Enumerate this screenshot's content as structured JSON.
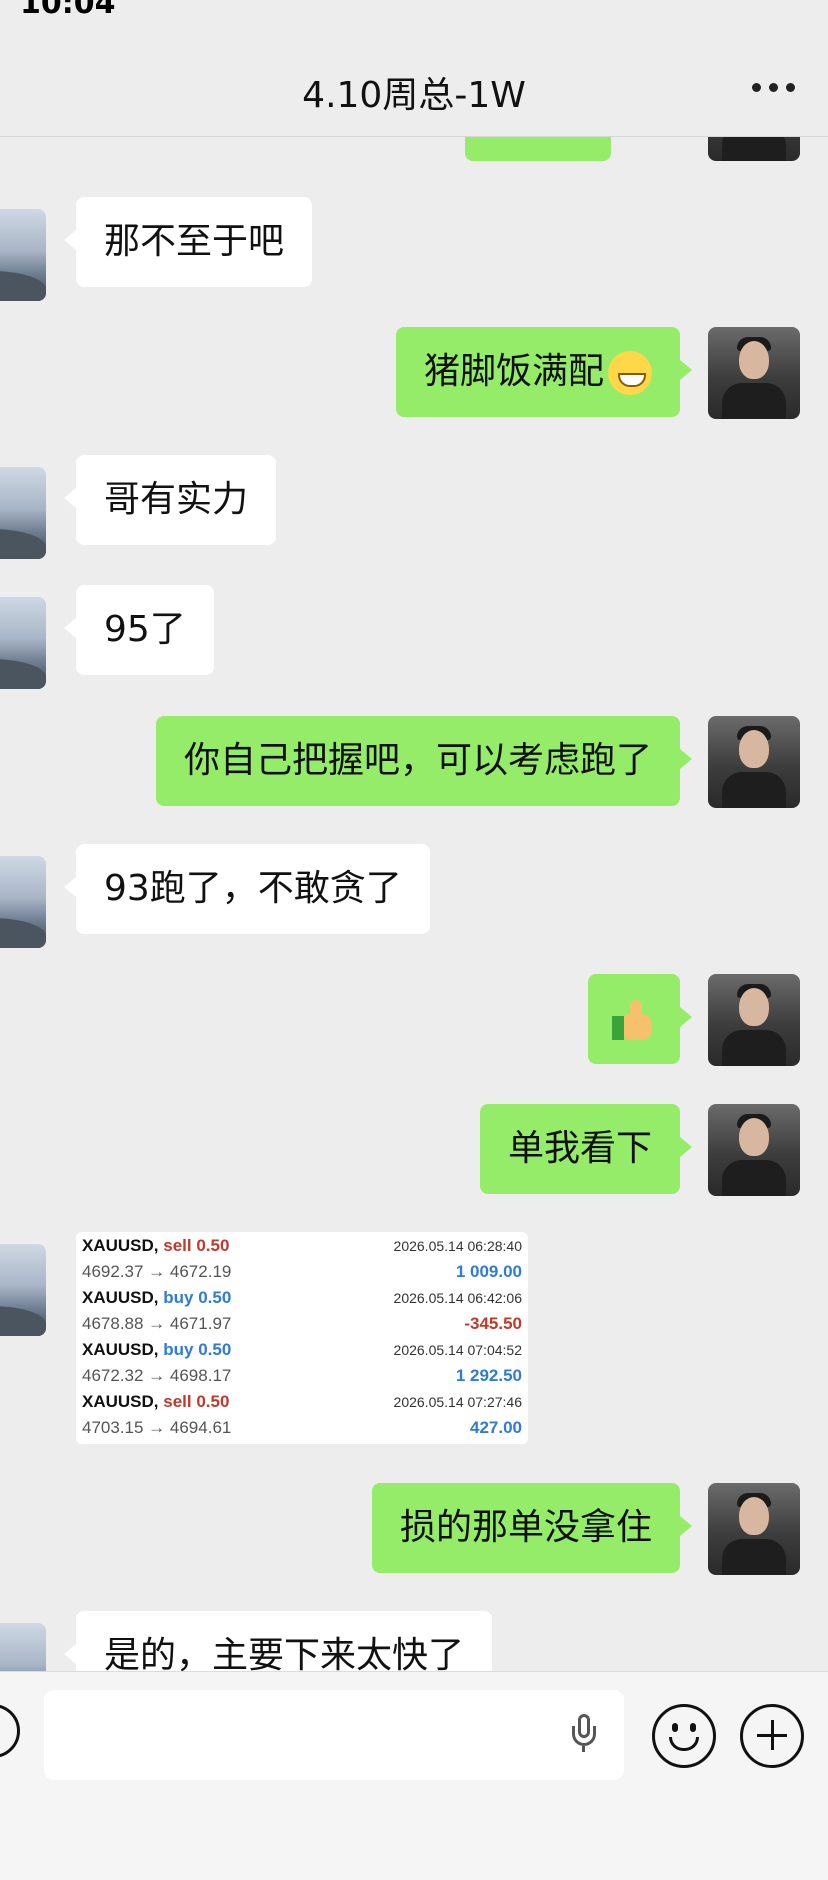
{
  "status_bar": {
    "time": "10:04"
  },
  "header": {
    "title": "4.10周总-1W"
  },
  "messages": [
    {
      "from": "other",
      "text": "那不至于吧"
    },
    {
      "from": "me",
      "text": "猪脚饭满配",
      "emoji": "grin-icon"
    },
    {
      "from": "other",
      "text": "哥有实力"
    },
    {
      "from": "other",
      "text": "95了"
    },
    {
      "from": "me",
      "text": "你自己把握吧，可以考虑跑了"
    },
    {
      "from": "other",
      "text": "93跑了，不敢贪了"
    },
    {
      "from": "me",
      "emoji": "thumbs-up-icon"
    },
    {
      "from": "me",
      "text": "单我看下"
    },
    {
      "from": "me",
      "text": "损的那单没拿住"
    },
    {
      "from": "other",
      "text": "是的，主要下来太快了"
    }
  ],
  "trade_card": {
    "rows": [
      {
        "symbol": "XAUUSD,",
        "side": "sell 0.50",
        "datetime": "2026.05.14 06:28:40",
        "prices": "4692.37 → 4672.19",
        "pl": "1 009.00"
      },
      {
        "symbol": "XAUUSD,",
        "side": "buy 0.50",
        "datetime": "2026.05.14 06:42:06",
        "prices": "4678.88 → 4671.97",
        "pl": "-345.50"
      },
      {
        "symbol": "XAUUSD,",
        "side": "buy 0.50",
        "datetime": "2026.05.14 07:04:52",
        "prices": "4672.32 → 4698.17",
        "pl": "1 292.50"
      },
      {
        "symbol": "XAUUSD,",
        "side": "sell 0.50",
        "datetime": "2026.05.14 07:27:46",
        "prices": "4703.15 → 4694.61",
        "pl": "427.00"
      }
    ]
  },
  "colors": {
    "my_bubble": "#95ec69",
    "other_bubble": "#ffffff",
    "sell": "#c0392b",
    "buy": "#2f7bd8"
  },
  "input_bar": {
    "icons": [
      "voice-icon",
      "microphone-icon",
      "emoji-icon",
      "plus-icon"
    ]
  }
}
